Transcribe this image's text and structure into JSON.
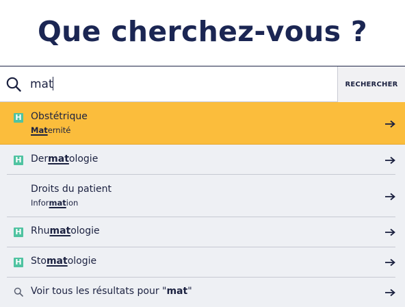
{
  "page": {
    "title": "Que cherchez-vous ?"
  },
  "search": {
    "value": "mat",
    "placeholder": "",
    "button_label": "RECHERCHER"
  },
  "colors": {
    "title": "#1b2653",
    "active_row": "#fbbd3c",
    "badge": "#4fc3a1",
    "list_bg": "#eef0f4"
  },
  "results": [
    {
      "badge": "H",
      "title_pre": "Obstétrique",
      "title_match": "",
      "title_post": "",
      "sub_pre": "",
      "sub_match": "Mat",
      "sub_post": "ernité",
      "active": true,
      "icon": "hospital-badge-icon"
    },
    {
      "badge": "H",
      "title_pre": "Der",
      "title_match": "mat",
      "title_post": "ologie",
      "active": false,
      "icon": "hospital-badge-icon"
    },
    {
      "badge": "",
      "title_pre": "Droits du patient",
      "title_match": "",
      "title_post": "",
      "sub_pre": "Infor",
      "sub_match": "mat",
      "sub_post": "ion",
      "active": false
    },
    {
      "badge": "H",
      "title_pre": "Rhu",
      "title_match": "mat",
      "title_post": "ologie",
      "active": false,
      "icon": "hospital-badge-icon"
    },
    {
      "badge": "H",
      "title_pre": "Sto",
      "title_match": "mat",
      "title_post": "ologie",
      "active": false,
      "icon": "hospital-badge-icon"
    }
  ],
  "all_results": {
    "prefix": "Voir tous les résultats pour \"",
    "query": "mat",
    "suffix": "\""
  }
}
